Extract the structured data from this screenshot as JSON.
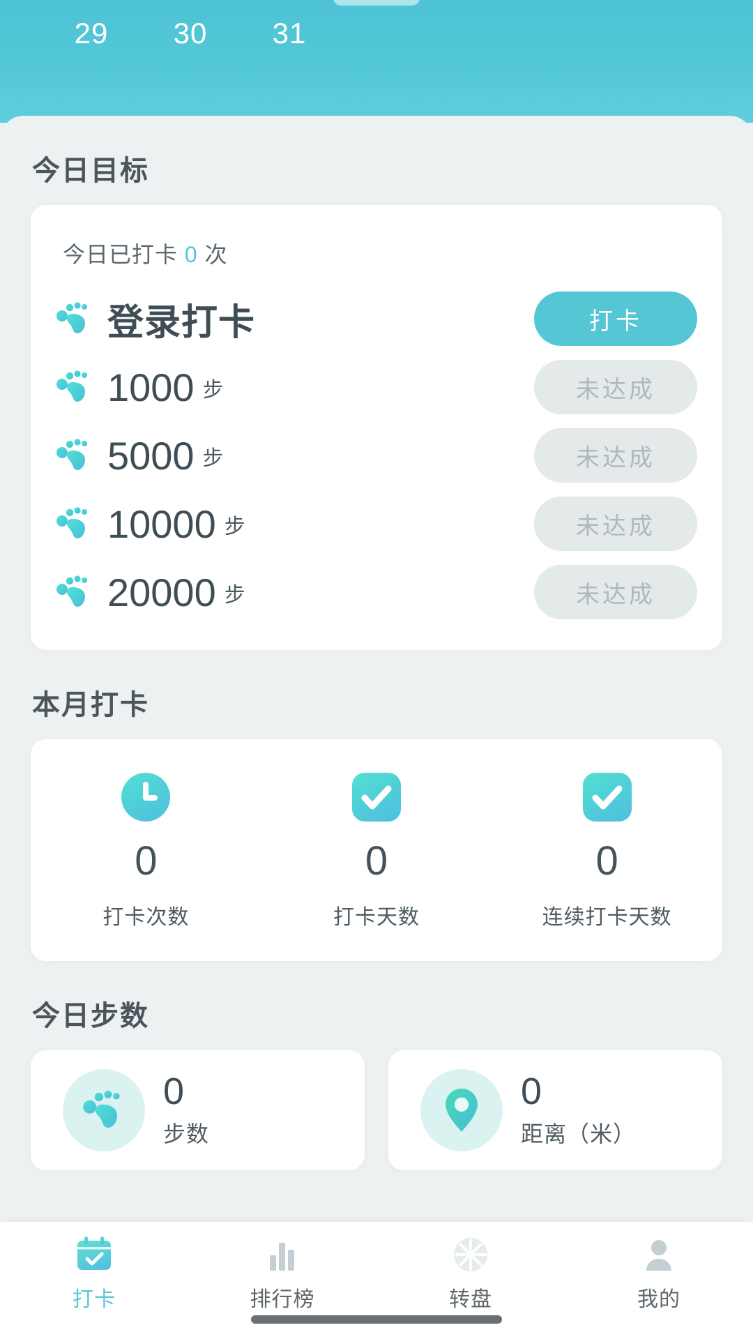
{
  "header": {
    "calendar_days": [
      "29",
      "30",
      "31"
    ]
  },
  "goals_section": {
    "title": "今日目标",
    "subtitle_prefix": "今日已打卡",
    "subtitle_count": "0",
    "subtitle_suffix": "次",
    "rows": [
      {
        "icon": "footprint-icon",
        "label": "登录打卡",
        "unit": "",
        "button_label": "打卡",
        "button_state": "active"
      },
      {
        "icon": "footprint-icon",
        "label": "1000",
        "unit": "步",
        "button_label": "未达成",
        "button_state": "done"
      },
      {
        "icon": "footprint-icon",
        "label": "5000",
        "unit": "步",
        "button_label": "未达成",
        "button_state": "done"
      },
      {
        "icon": "footprint-icon",
        "label": "10000",
        "unit": "步",
        "button_label": "未达成",
        "button_state": "done"
      },
      {
        "icon": "footprint-icon",
        "label": "20000",
        "unit": "步",
        "button_label": "未达成",
        "button_state": "done"
      }
    ]
  },
  "month_section": {
    "title": "本月打卡",
    "stats": [
      {
        "icon": "clock-icon",
        "value": "0",
        "label": "打卡次数"
      },
      {
        "icon": "check-box-icon",
        "value": "0",
        "label": "打卡天数"
      },
      {
        "icon": "check-box-icon",
        "value": "0",
        "label": "连续打卡天数"
      }
    ]
  },
  "steps_section": {
    "title": "今日步数",
    "cards": [
      {
        "icon": "footprint-icon",
        "value": "0",
        "label": "步数"
      },
      {
        "icon": "location-pin-icon",
        "value": "0",
        "label": "距离（米）"
      }
    ]
  },
  "tabbar": {
    "items": [
      {
        "icon": "calendar-check-icon",
        "label": "打卡",
        "active": true
      },
      {
        "icon": "bar-chart-icon",
        "label": "排行榜",
        "active": false
      },
      {
        "icon": "wheel-icon",
        "label": "转盘",
        "active": false
      },
      {
        "icon": "person-icon",
        "label": "我的",
        "active": false
      }
    ]
  },
  "colors": {
    "brand_teal": "#55c6d4",
    "header_gradient_from": "#4ec3d6",
    "header_gradient_to": "#5ecede",
    "accent_cyan": "#4ec8d8",
    "disabled_bg": "#e4e9ea",
    "disabled_text": "#aeb9bd",
    "page_bg": "#eef1f1",
    "text_dark": "#3f4d54"
  }
}
